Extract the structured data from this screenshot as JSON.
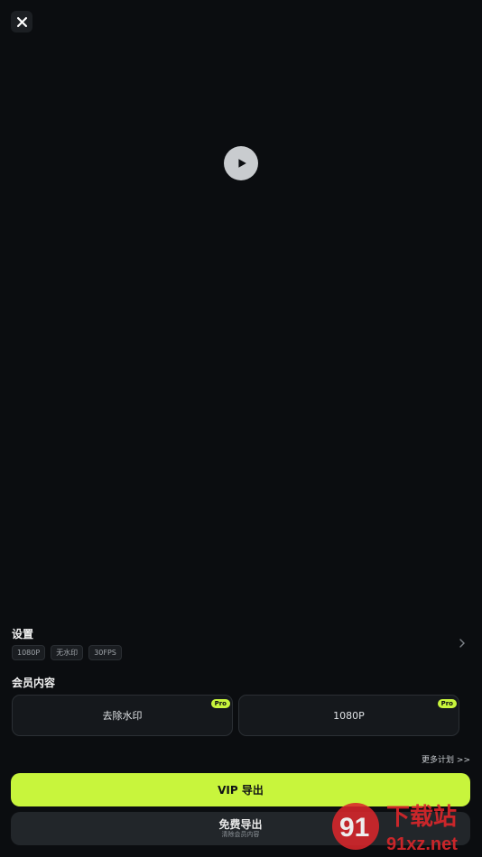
{
  "header": {
    "close_icon": "close-icon"
  },
  "video": {
    "play_icon": "play-icon"
  },
  "settings": {
    "title": "设置",
    "chips": [
      "1080P",
      "无水印",
      "30FPS"
    ]
  },
  "member": {
    "title": "会员内容",
    "cards": [
      {
        "label": "去除水印",
        "badge": "Pro"
      },
      {
        "label": "1080P",
        "badge": "Pro"
      }
    ],
    "more_plans": "更多计划 >>"
  },
  "actions": {
    "vip_export": "VIP 导出",
    "free_export": "免费导出",
    "free_export_sub": "清除会员内容"
  },
  "watermark": {
    "text_top": "下载站",
    "text_bottom": "91xz.net"
  },
  "colors": {
    "accent": "#c8f53c",
    "background": "#0b0d10"
  }
}
